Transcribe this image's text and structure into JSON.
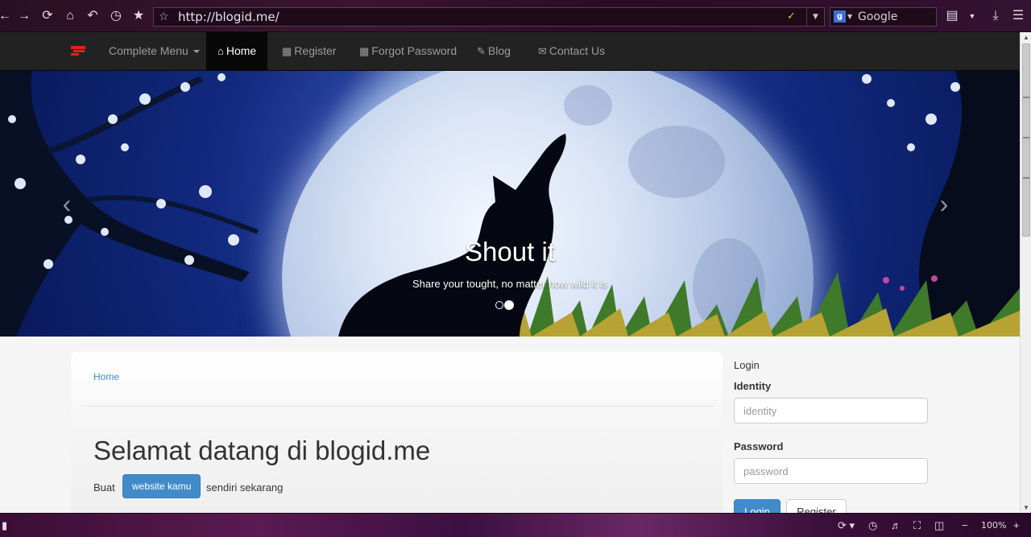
{
  "browser": {
    "url": "http://blogid.me/",
    "search_engine": "Google",
    "zoom": "100%",
    "icons": [
      "back-arrow-icon",
      "forward-arrow-icon",
      "reload-icon",
      "home-icon",
      "undo-icon",
      "history-clock-icon",
      "bookmark-star-icon",
      "bookmark-page-icon",
      "go-arrow-icon",
      "google-icon",
      "download-icon",
      "menu-icon"
    ]
  },
  "navbar": {
    "items": [
      {
        "label": "Complete Menu",
        "icon": "caret-down-icon"
      },
      {
        "label": "Home",
        "icon": "home-icon"
      },
      {
        "label": "Register",
        "icon": "grid-icon"
      },
      {
        "label": "Forgot Password",
        "icon": "grid-icon"
      },
      {
        "label": "Blog",
        "icon": "pencil-icon"
      },
      {
        "label": "Contact Us",
        "icon": "envelope-icon"
      }
    ],
    "active": "Home",
    "brand_color": "#d9251d"
  },
  "carousel": {
    "title": "Shout it",
    "subtitle": "Share your tought, no matter how wild it is",
    "slide_count": 2,
    "active_slide": 2
  },
  "main": {
    "breadcrumb": "Home",
    "heading": "Selamat datang di blogid.me",
    "intro_before": "Buat",
    "intro_button": "website kamu",
    "intro_after": "sendiri sekarang",
    "accent": "#428bca"
  },
  "sidebar": {
    "title": "Login",
    "identity_label": "Identity",
    "identity_placeholder": "identity",
    "password_label": "Password",
    "password_placeholder": "password",
    "login_button": "Login",
    "register_button": "Register"
  }
}
